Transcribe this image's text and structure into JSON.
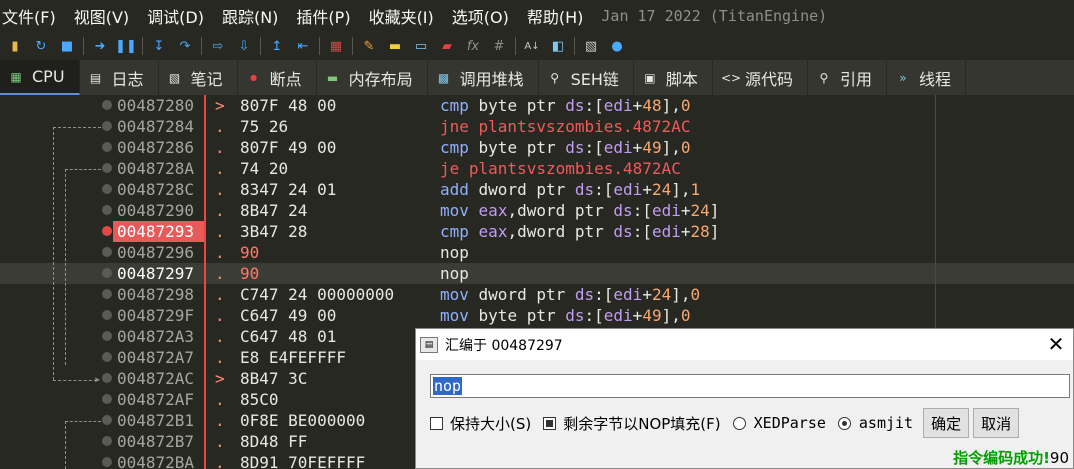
{
  "menu": {
    "items": [
      "文件(F)",
      "视图(V)",
      "调试(D)",
      "跟踪(N)",
      "插件(P)",
      "收藏夹(I)",
      "选项(O)",
      "帮助(H)"
    ],
    "build": "Jan 17 2022 (TitanEngine)"
  },
  "toolbar": {
    "icons": [
      "open-folder-icon",
      "restart-icon",
      "stop-icon",
      "run-icon",
      "pause-icon",
      "step-into-icon",
      "step-over-icon",
      "trace-into-icon",
      "trace-over-icon",
      "execute-till-return-icon",
      "run-to-user-code-icon",
      "script-icon",
      "pencil-icon",
      "highlight-icon",
      "comment-icon",
      "breakpoint-icon",
      "function-icon",
      "hash-icon",
      "font-icon",
      "bookmark-icon",
      "calculator-icon",
      "globe-icon"
    ]
  },
  "tabs": [
    {
      "label": "CPU",
      "icon": "cpu-icon"
    },
    {
      "label": "日志",
      "icon": "log-icon"
    },
    {
      "label": "笔记",
      "icon": "notes-icon"
    },
    {
      "label": "断点",
      "icon": "breakpoint-dot-icon"
    },
    {
      "label": "内存布局",
      "icon": "memory-map-icon"
    },
    {
      "label": "调用堆栈",
      "icon": "call-stack-icon"
    },
    {
      "label": "SEH链",
      "icon": "seh-icon"
    },
    {
      "label": "脚本",
      "icon": "script-icon"
    },
    {
      "label": "源代码",
      "icon": "source-icon"
    },
    {
      "label": "引用",
      "icon": "references-icon"
    },
    {
      "label": "线程",
      "icon": "threads-icon"
    }
  ],
  "disasm": {
    "rows": [
      {
        "addr": "00487280",
        "mark": ">",
        "bytes": "807F 48 00"
      },
      {
        "addr": "00487284",
        "mark": ".",
        "bytes": "75 26"
      },
      {
        "addr": "00487286",
        "mark": ".",
        "bytes": "807F 49 00"
      },
      {
        "addr": "0048728A",
        "mark": ".",
        "bytes": "74 20"
      },
      {
        "addr": "0048728C",
        "mark": ".",
        "bytes": "8347 24 01"
      },
      {
        "addr": "00487290",
        "mark": ".",
        "bytes": "8B47 24"
      },
      {
        "addr": "00487293",
        "mark": ".",
        "bytes": "3B47 28"
      },
      {
        "addr": "00487296",
        "mark": ".",
        "bytes": "90"
      },
      {
        "addr": "00487297",
        "mark": ".",
        "bytes": "90"
      },
      {
        "addr": "00487298",
        "mark": ".",
        "bytes": "C747 24 00000000"
      },
      {
        "addr": "0048729F",
        "mark": ".",
        "bytes": "C647 49 00"
      },
      {
        "addr": "004872A3",
        "mark": ".",
        "bytes": "C647 48 01"
      },
      {
        "addr": "004872A7",
        "mark": ".",
        "bytes": "E8 E4FEFFFF"
      },
      {
        "addr": "004872AC",
        "mark": ">",
        "bytes": "8B47 3C"
      },
      {
        "addr": "004872AF",
        "mark": ".",
        "bytes": "85C0"
      },
      {
        "addr": "004872B1",
        "mark": ".",
        "bytes": "0F8E BE000000"
      },
      {
        "addr": "004872B7",
        "mark": ".",
        "bytes": "8D48 FF"
      },
      {
        "addr": "004872BA",
        "mark": ".",
        "bytes": "8D91 70FEFFFF"
      }
    ],
    "instructions": [
      [
        [
          "k",
          "cmp"
        ],
        [
          "t",
          " byte ptr "
        ],
        [
          "r",
          "ds"
        ],
        [
          "t",
          ":["
        ],
        [
          "r",
          "edi"
        ],
        [
          "t",
          "+"
        ],
        [
          "n",
          "48"
        ],
        [
          "t",
          "],"
        ],
        [
          "n",
          "0"
        ]
      ],
      [
        [
          "kj",
          "jne plantsvszombies.4872AC"
        ]
      ],
      [
        [
          "k",
          "cmp"
        ],
        [
          "t",
          " byte ptr "
        ],
        [
          "r",
          "ds"
        ],
        [
          "t",
          ":["
        ],
        [
          "r",
          "edi"
        ],
        [
          "t",
          "+"
        ],
        [
          "n",
          "49"
        ],
        [
          "t",
          "],"
        ],
        [
          "n",
          "0"
        ]
      ],
      [
        [
          "kj",
          "je plantsvszombies.4872AC"
        ]
      ],
      [
        [
          "k",
          "add"
        ],
        [
          "t",
          " dword ptr "
        ],
        [
          "r",
          "ds"
        ],
        [
          "t",
          ":["
        ],
        [
          "r",
          "edi"
        ],
        [
          "t",
          "+"
        ],
        [
          "n",
          "24"
        ],
        [
          "t",
          "],"
        ],
        [
          "n",
          "1"
        ]
      ],
      [
        [
          "k",
          "mov"
        ],
        [
          "t",
          " "
        ],
        [
          "r",
          "eax"
        ],
        [
          "t",
          ",dword ptr "
        ],
        [
          "r",
          "ds"
        ],
        [
          "t",
          ":["
        ],
        [
          "r",
          "edi"
        ],
        [
          "t",
          "+"
        ],
        [
          "n",
          "24"
        ],
        [
          "t",
          "]"
        ]
      ],
      [
        [
          "k",
          "cmp"
        ],
        [
          "t",
          " "
        ],
        [
          "r",
          "eax"
        ],
        [
          "t",
          ",dword ptr "
        ],
        [
          "r",
          "ds"
        ],
        [
          "t",
          ":["
        ],
        [
          "r",
          "edi"
        ],
        [
          "t",
          "+"
        ],
        [
          "n",
          "28"
        ],
        [
          "t",
          "]"
        ]
      ],
      [
        [
          "t",
          "nop"
        ]
      ],
      [
        [
          "t",
          "nop"
        ]
      ],
      [
        [
          "k",
          "mov"
        ],
        [
          "t",
          " dword ptr "
        ],
        [
          "r",
          "ds"
        ],
        [
          "t",
          ":["
        ],
        [
          "r",
          "edi"
        ],
        [
          "t",
          "+"
        ],
        [
          "n",
          "24"
        ],
        [
          "t",
          "],"
        ],
        [
          "n",
          "0"
        ]
      ],
      [
        [
          "k",
          "mov"
        ],
        [
          "t",
          " byte ptr "
        ],
        [
          "r",
          "ds"
        ],
        [
          "t",
          ":["
        ],
        [
          "r",
          "edi"
        ],
        [
          "t",
          "+"
        ],
        [
          "n",
          "49"
        ],
        [
          "t",
          "],"
        ],
        [
          "n",
          "0"
        ]
      ]
    ]
  },
  "dialog": {
    "title": "汇编于 00487297",
    "input_value": "nop",
    "opt_keep_size": "保持大小(S)",
    "opt_fill_nop": "剩余字节以NOP填充(F)",
    "opt_xedparse": "XEDParse",
    "opt_asmjit": "asmjit",
    "ok_label": "确定",
    "cancel_label": "取消",
    "status_text": "指令编码成功!",
    "status_bytes": "90"
  }
}
